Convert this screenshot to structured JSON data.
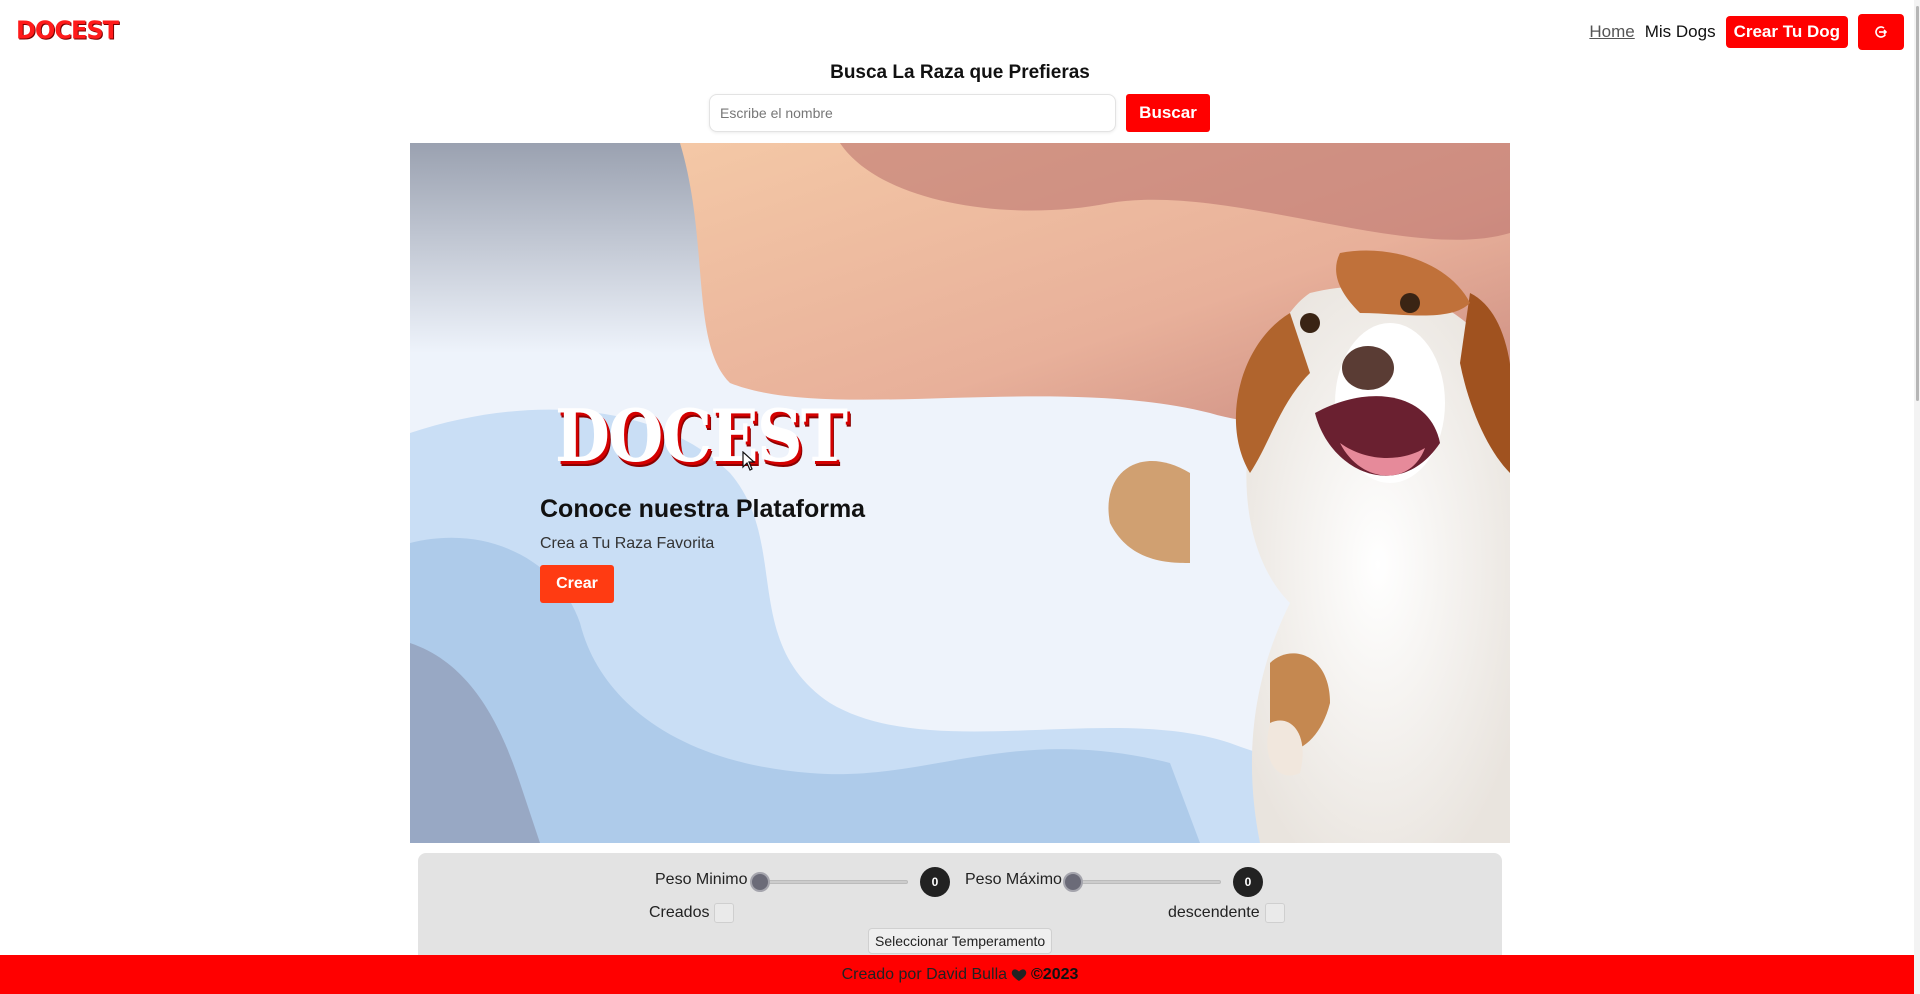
{
  "header": {
    "logo_text": "DOCEST",
    "nav": {
      "home": "Home",
      "mis_dogs": "Mis Dogs",
      "crear_dog": "Crear Tu Dog",
      "logout_icon": "logout-icon"
    }
  },
  "search": {
    "title": "Busca La Raza que Prefieras",
    "placeholder": "Escribe el nombre",
    "button": "Buscar"
  },
  "hero": {
    "logo_text": "DOCEST",
    "title": "Conoce nuestra Plataforma",
    "subtitle": "Crea a Tu Raza Favorita",
    "button": "Crear"
  },
  "filters": {
    "peso_minimo_label": "Peso Minimo",
    "peso_minimo_value": "0",
    "peso_maximo_label": "Peso Máximo",
    "peso_maximo_value": "0",
    "creados_label": "Creados",
    "descendente_label": "descendente",
    "temperamento_button": "Seleccionar Temperamento"
  },
  "footer": {
    "text": "Creado por David Bulla",
    "heart_icon": "heart-icon",
    "copyright": "©2023"
  },
  "colors": {
    "brand_red": "#ff0000",
    "hero_button": "#ff3b12"
  }
}
